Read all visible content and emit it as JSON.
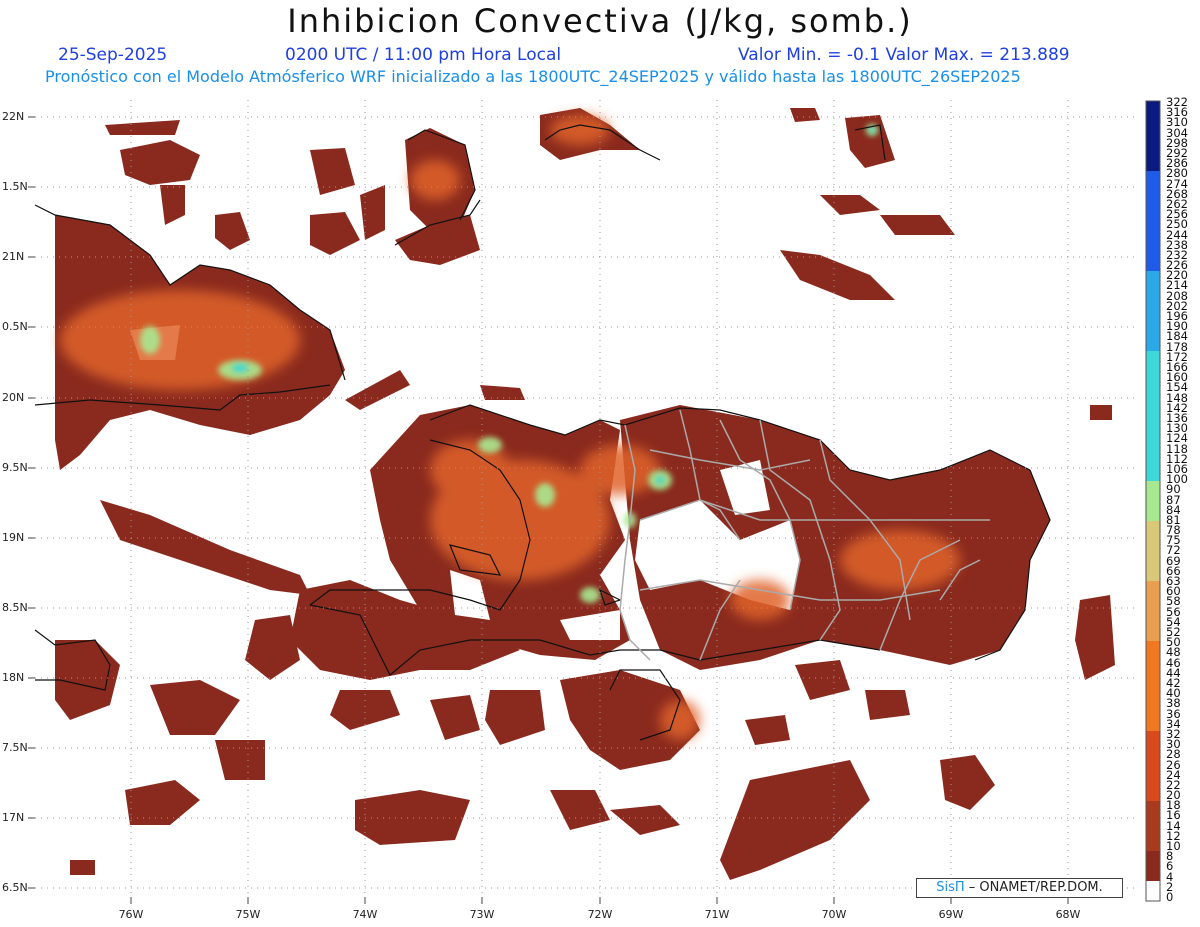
{
  "title": "Inhibicion Convectiva (J/kg, somb.)",
  "header": {
    "date": "25-Sep-2025",
    "time": "0200 UTC / 11:00 pm Hora Local",
    "minmax": "Valor Min. = -0.1  Valor Max. = 213.889",
    "model_info": "Pronóstico con el Modelo Atmósferico WRF inicializado a las 1800UTC_24SEP2025 y válido hasta las  1800UTC_26SEP2025"
  },
  "axes": {
    "lat_labels": [
      "22N",
      "1.5N",
      "21N",
      "0.5N",
      "20N",
      "9.5N",
      "19N",
      "8.5N",
      "18N",
      "7.5N",
      "17N",
      "6.5N"
    ],
    "lon_labels": [
      "76W",
      "75W",
      "74W",
      "73W",
      "72W",
      "71W",
      "70W",
      "69W",
      "68W"
    ]
  },
  "colorbar": {
    "labels": [
      "322",
      "316",
      "310",
      "304",
      "298",
      "292",
      "286",
      "280",
      "274",
      "268",
      "262",
      "256",
      "250",
      "244",
      "238",
      "232",
      "226",
      "220",
      "214",
      "208",
      "202",
      "196",
      "190",
      "184",
      "178",
      "172",
      "166",
      "160",
      "154",
      "148",
      "142",
      "136",
      "130",
      "124",
      "118",
      "112",
      "106",
      "100",
      "90",
      "87",
      "84",
      "81",
      "78",
      "75",
      "72",
      "69",
      "66",
      "63",
      "60",
      "58",
      "56",
      "54",
      "52",
      "50",
      "48",
      "46",
      "44",
      "42",
      "40",
      "38",
      "36",
      "34",
      "32",
      "30",
      "28",
      "26",
      "24",
      "22",
      "20",
      "18",
      "16",
      "14",
      "12",
      "10",
      "8",
      "6",
      "4",
      "2",
      "0"
    ],
    "colors": {
      "dark_blue": "#0a1a80",
      "blue": "#1e5be8",
      "light_blue": "#2aa8e8",
      "cyan": "#3fd8d8",
      "pale_green": "#a8e890",
      "khaki": "#d8c878",
      "orange": "#f07820",
      "red_orange": "#d84a1e",
      "brown": "#8a2a1e",
      "dark_brown": "#6a1e1a"
    }
  },
  "credit": {
    "sis": "SisΠ",
    "org": " – ONAMET/REP.DOM."
  }
}
